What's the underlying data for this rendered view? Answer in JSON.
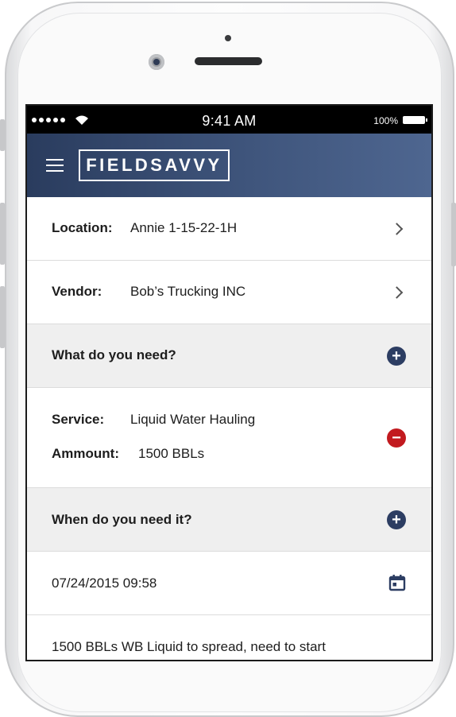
{
  "status_bar": {
    "time": "9:41 AM",
    "battery_percent": "100%"
  },
  "header": {
    "logo": "FIELDSAVVY"
  },
  "location": {
    "label": "Location:",
    "value": "Annie 1-15-22-1H"
  },
  "vendor": {
    "label": "Vendor:",
    "value": "Bob’s Trucking INC"
  },
  "what_section": {
    "title": "What do you need?"
  },
  "service_item": {
    "service_label": "Service:",
    "service_value": "Liquid Water Hauling",
    "amount_label": "Ammount:",
    "amount_value": "1500 BBLs"
  },
  "when_section": {
    "title": "When do you need it?"
  },
  "datetime": {
    "value": "07/24/2015 09:58"
  },
  "notes": {
    "text": "1500 BBLs WB Liquid to spread, need to start"
  },
  "colors": {
    "header_start": "#2a3c5e",
    "header_end": "#4e6690",
    "plus_button": "#2c3d62",
    "minus_button": "#c21a1f"
  },
  "icons": [
    "menu-icon",
    "chevron-right-icon",
    "plus-circle-icon",
    "minus-circle-icon",
    "calendar-icon",
    "wifi-icon",
    "battery-icon"
  ]
}
